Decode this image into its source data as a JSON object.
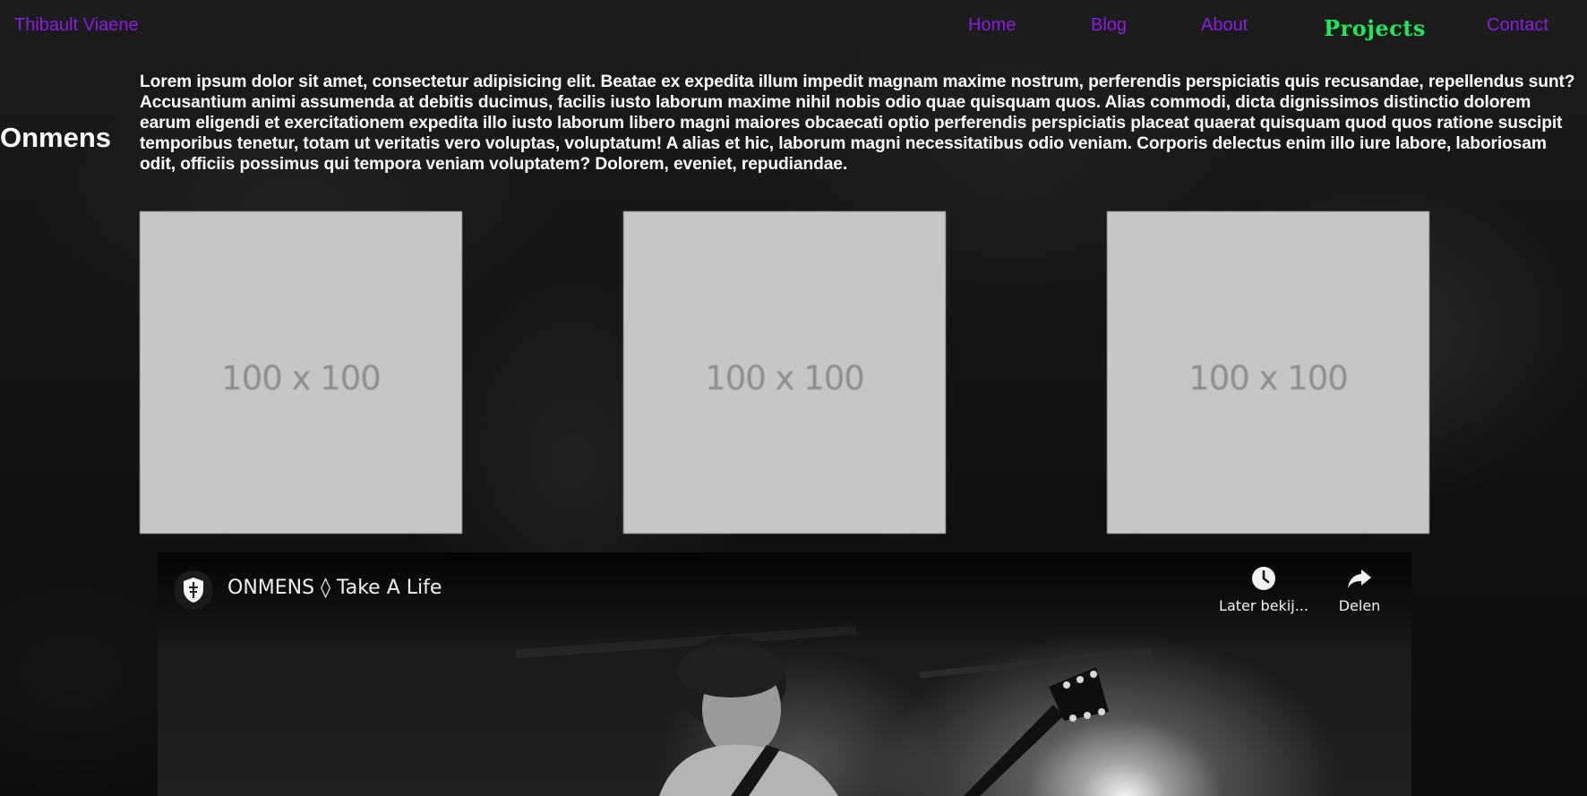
{
  "header": {
    "brand": "Thibault Viaene",
    "nav": [
      {
        "label": "Home"
      },
      {
        "label": "Blog"
      },
      {
        "label": "About"
      },
      {
        "label": "Projects",
        "active": true
      },
      {
        "label": "Contact"
      }
    ]
  },
  "section": {
    "title": "Onmens",
    "intro": "Lorem ipsum dolor sit amet, consectetur adipisicing elit. Beatae ex expedita illum impedit magnam maxime nostrum, perferendis perspiciatis quis recusandae, repellendus sunt? Accusantium animi assumenda at debitis ducimus, facilis iusto laborum maxime nihil nobis odio quae quisquam quos. Alias commodi, dicta dignissimos distinctio dolorem earum eligendi et exercitationem expedita illo iusto laborum libero magni maiores obcaecati optio perferendis perspiciatis placeat quaerat quisquam quod quos ratione suscipit temporibus tenetur, totam ut veritatis vero voluptas, voluptatum! A alias et hic, laborum magni necessitatibus odio veniam. Corporis delectus enim illo iure labore, laboriosam odit, officiis possimus qui tempora veniam voluptatem? Dolorem, eveniet, repudiandae."
  },
  "thumbnails": [
    {
      "label": "100 x 100"
    },
    {
      "label": "100 x 100"
    },
    {
      "label": "100 x 100"
    }
  ],
  "video": {
    "title": "ONMENS ◊ Take A Life",
    "actions": {
      "watch_later": "Later bekij...",
      "share": "Delen"
    },
    "icons": {
      "channel": "shield-crest-icon",
      "watch_later": "clock-icon",
      "share": "share-arrow-icon"
    }
  },
  "colors": {
    "nav_link": "#8a1ee0",
    "nav_active": "#1ee85a",
    "text": "#ffffff",
    "placeholder_bg": "#c6c6c6",
    "placeholder_text": "#8d8d8d"
  }
}
